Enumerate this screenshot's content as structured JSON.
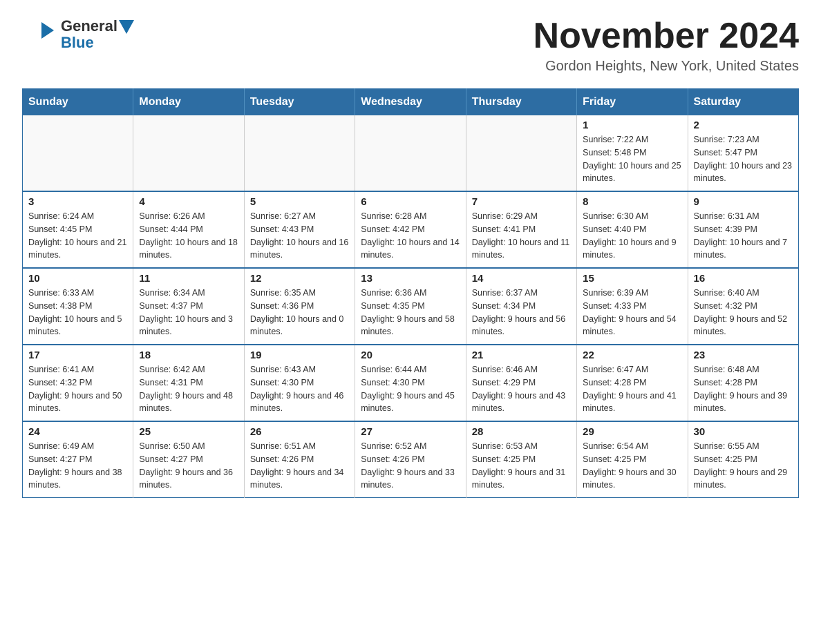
{
  "header": {
    "logo_general": "General",
    "logo_blue": "Blue",
    "month_title": "November 2024",
    "location": "Gordon Heights, New York, United States"
  },
  "weekdays": [
    "Sunday",
    "Monday",
    "Tuesday",
    "Wednesday",
    "Thursday",
    "Friday",
    "Saturday"
  ],
  "weeks": [
    [
      {
        "day": "",
        "info": ""
      },
      {
        "day": "",
        "info": ""
      },
      {
        "day": "",
        "info": ""
      },
      {
        "day": "",
        "info": ""
      },
      {
        "day": "",
        "info": ""
      },
      {
        "day": "1",
        "info": "Sunrise: 7:22 AM\nSunset: 5:48 PM\nDaylight: 10 hours and 25 minutes."
      },
      {
        "day": "2",
        "info": "Sunrise: 7:23 AM\nSunset: 5:47 PM\nDaylight: 10 hours and 23 minutes."
      }
    ],
    [
      {
        "day": "3",
        "info": "Sunrise: 6:24 AM\nSunset: 4:45 PM\nDaylight: 10 hours and 21 minutes."
      },
      {
        "day": "4",
        "info": "Sunrise: 6:26 AM\nSunset: 4:44 PM\nDaylight: 10 hours and 18 minutes."
      },
      {
        "day": "5",
        "info": "Sunrise: 6:27 AM\nSunset: 4:43 PM\nDaylight: 10 hours and 16 minutes."
      },
      {
        "day": "6",
        "info": "Sunrise: 6:28 AM\nSunset: 4:42 PM\nDaylight: 10 hours and 14 minutes."
      },
      {
        "day": "7",
        "info": "Sunrise: 6:29 AM\nSunset: 4:41 PM\nDaylight: 10 hours and 11 minutes."
      },
      {
        "day": "8",
        "info": "Sunrise: 6:30 AM\nSunset: 4:40 PM\nDaylight: 10 hours and 9 minutes."
      },
      {
        "day": "9",
        "info": "Sunrise: 6:31 AM\nSunset: 4:39 PM\nDaylight: 10 hours and 7 minutes."
      }
    ],
    [
      {
        "day": "10",
        "info": "Sunrise: 6:33 AM\nSunset: 4:38 PM\nDaylight: 10 hours and 5 minutes."
      },
      {
        "day": "11",
        "info": "Sunrise: 6:34 AM\nSunset: 4:37 PM\nDaylight: 10 hours and 3 minutes."
      },
      {
        "day": "12",
        "info": "Sunrise: 6:35 AM\nSunset: 4:36 PM\nDaylight: 10 hours and 0 minutes."
      },
      {
        "day": "13",
        "info": "Sunrise: 6:36 AM\nSunset: 4:35 PM\nDaylight: 9 hours and 58 minutes."
      },
      {
        "day": "14",
        "info": "Sunrise: 6:37 AM\nSunset: 4:34 PM\nDaylight: 9 hours and 56 minutes."
      },
      {
        "day": "15",
        "info": "Sunrise: 6:39 AM\nSunset: 4:33 PM\nDaylight: 9 hours and 54 minutes."
      },
      {
        "day": "16",
        "info": "Sunrise: 6:40 AM\nSunset: 4:32 PM\nDaylight: 9 hours and 52 minutes."
      }
    ],
    [
      {
        "day": "17",
        "info": "Sunrise: 6:41 AM\nSunset: 4:32 PM\nDaylight: 9 hours and 50 minutes."
      },
      {
        "day": "18",
        "info": "Sunrise: 6:42 AM\nSunset: 4:31 PM\nDaylight: 9 hours and 48 minutes."
      },
      {
        "day": "19",
        "info": "Sunrise: 6:43 AM\nSunset: 4:30 PM\nDaylight: 9 hours and 46 minutes."
      },
      {
        "day": "20",
        "info": "Sunrise: 6:44 AM\nSunset: 4:30 PM\nDaylight: 9 hours and 45 minutes."
      },
      {
        "day": "21",
        "info": "Sunrise: 6:46 AM\nSunset: 4:29 PM\nDaylight: 9 hours and 43 minutes."
      },
      {
        "day": "22",
        "info": "Sunrise: 6:47 AM\nSunset: 4:28 PM\nDaylight: 9 hours and 41 minutes."
      },
      {
        "day": "23",
        "info": "Sunrise: 6:48 AM\nSunset: 4:28 PM\nDaylight: 9 hours and 39 minutes."
      }
    ],
    [
      {
        "day": "24",
        "info": "Sunrise: 6:49 AM\nSunset: 4:27 PM\nDaylight: 9 hours and 38 minutes."
      },
      {
        "day": "25",
        "info": "Sunrise: 6:50 AM\nSunset: 4:27 PM\nDaylight: 9 hours and 36 minutes."
      },
      {
        "day": "26",
        "info": "Sunrise: 6:51 AM\nSunset: 4:26 PM\nDaylight: 9 hours and 34 minutes."
      },
      {
        "day": "27",
        "info": "Sunrise: 6:52 AM\nSunset: 4:26 PM\nDaylight: 9 hours and 33 minutes."
      },
      {
        "day": "28",
        "info": "Sunrise: 6:53 AM\nSunset: 4:25 PM\nDaylight: 9 hours and 31 minutes."
      },
      {
        "day": "29",
        "info": "Sunrise: 6:54 AM\nSunset: 4:25 PM\nDaylight: 9 hours and 30 minutes."
      },
      {
        "day": "30",
        "info": "Sunrise: 6:55 AM\nSunset: 4:25 PM\nDaylight: 9 hours and 29 minutes."
      }
    ]
  ]
}
